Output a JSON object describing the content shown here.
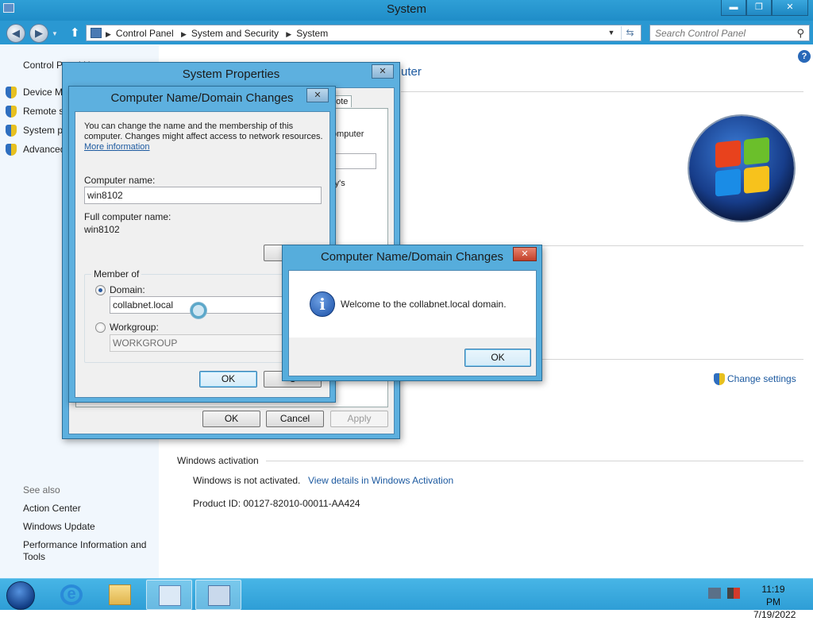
{
  "window": {
    "title": "System"
  },
  "titlebar_buttons": {
    "minimize": "▬",
    "maximize": "❐",
    "close": "✕"
  },
  "nav": {
    "back_icon": "back-arrow-icon",
    "forward_icon": "forward-arrow-icon",
    "breadcrumbs": [
      "Control Panel",
      "System and Security",
      "System"
    ],
    "search_placeholder": "Search Control Panel"
  },
  "leftpane": {
    "home": "Control Panel Home",
    "tasks": [
      "Device Manager",
      "Remote settings",
      "System protection",
      "Advanced system settings"
    ],
    "see_also_title": "See also",
    "see_also": [
      "Action Center",
      "Windows Update",
      "Performance Information and Tools"
    ]
  },
  "content": {
    "heading_fragment": "uter",
    "change_settings": "Change settings",
    "activation_section": "Windows activation",
    "activation_status": "Windows is not activated.",
    "activation_link": "View details in Windows Activation",
    "product_id": "Product ID: 00127-82010-00011-AA424"
  },
  "system_properties": {
    "title": "System Properties",
    "close": "✕",
    "tab_fragment": "note",
    "frag_computer": "omputer",
    "frag_ys": "ry's",
    "ok": "OK",
    "cancel": "Cancel",
    "apply": "Apply"
  },
  "name_dialog": {
    "title": "Computer Name/Domain Changes",
    "close": "✕",
    "description_line1": "You can change the name and the membership of this",
    "description_line2": "computer. Changes might affect access to network resources.",
    "more_info": "More information",
    "computer_name_label": "Computer name:",
    "computer_name_value": "win8102",
    "full_name_label": "Full computer name:",
    "full_name_value": "win8102",
    "more_button_fragment": "M",
    "member_of": "Member of",
    "domain_label": "Domain:",
    "domain_value": "collabnet.local",
    "workgroup_label": "Workgroup:",
    "workgroup_value": "WORKGROUP",
    "ok": "OK",
    "cancel_fragment": "C"
  },
  "message_box": {
    "title": "Computer Name/Domain Changes",
    "close": "✕",
    "message": "Welcome to the collabnet.local domain.",
    "ok": "OK",
    "icon": "info-icon"
  },
  "taskbar": {
    "time": "11:19 PM",
    "date": "7/19/2022",
    "items": [
      "internet-explorer-icon",
      "file-explorer-icon",
      "control-panel-icon",
      "system-properties-icon"
    ]
  }
}
